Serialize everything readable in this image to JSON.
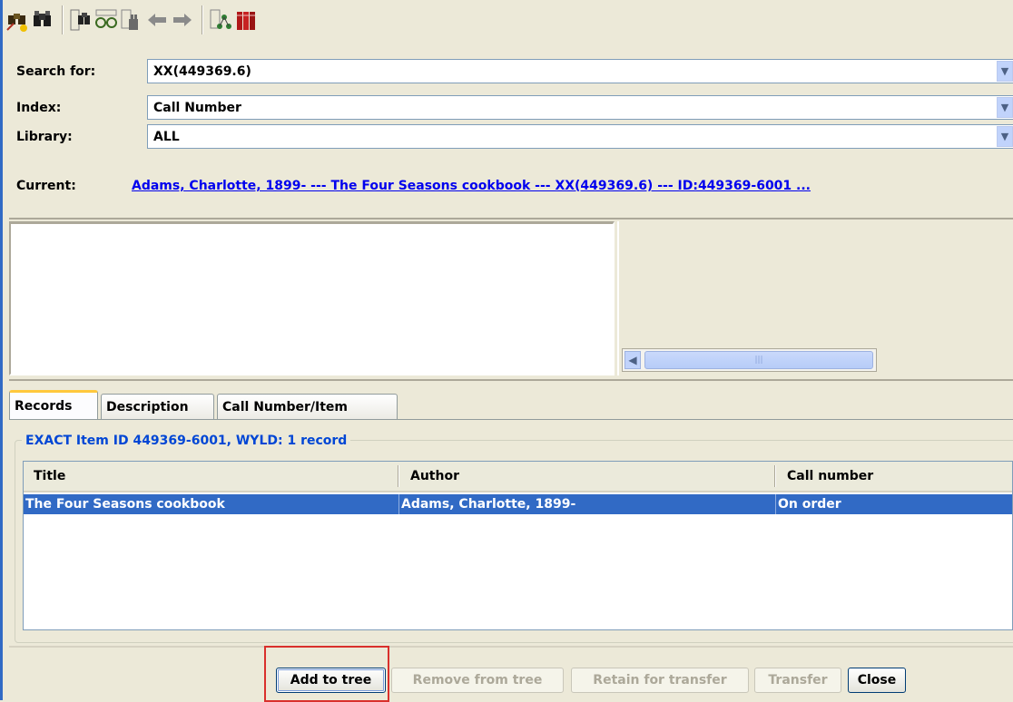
{
  "search": {
    "search_for_label": "Search for:",
    "search_for_value": "XX(449369.6)",
    "index_label": "Index:",
    "index_value": "Call Number",
    "library_label": "Library:",
    "library_value": "ALL",
    "current_label": "Current:",
    "current_value": "Adams, Charlotte, 1899- --- The Four Seasons cookbook --- XX(449369.6) --- ID:449369-6001 ..."
  },
  "toolbar": {
    "icons": [
      "search-tool-icon",
      "binoculars-icon",
      "binoculars-list-icon",
      "glasses-icon",
      "hand-search-icon",
      "back-arrow-icon",
      "forward-arrow-icon",
      "tree-icon",
      "books-icon"
    ]
  },
  "tabs": [
    {
      "label": "Records",
      "active": true
    },
    {
      "label": "Description",
      "active": false
    },
    {
      "label": "Call Number/Item",
      "active": false
    }
  ],
  "records": {
    "group_title": "EXACT Item ID 449369-6001, WYLD: 1 record",
    "columns": [
      "Title",
      "Author",
      "Call number"
    ],
    "rows": [
      {
        "title": "The Four Seasons cookbook",
        "author": "Adams, Charlotte, 1899-",
        "call_number": "On order",
        "selected": true
      }
    ]
  },
  "buttons": {
    "add_to_tree": "Add to tree",
    "remove_from_tree": "Remove from tree",
    "retain_for_transfer": "Retain for transfer",
    "transfer": "Transfer",
    "close": "Close"
  },
  "colors": {
    "selection": "#316ac5",
    "link": "#0000ee",
    "group_title": "#0046d5",
    "highlight": "#d9302c"
  }
}
